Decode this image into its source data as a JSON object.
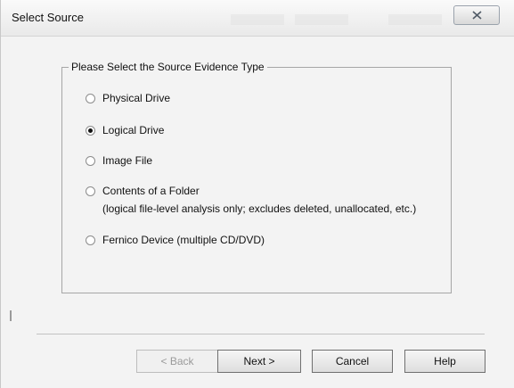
{
  "window": {
    "title": "Select Source",
    "close_icon": "close-icon"
  },
  "group": {
    "legend": "Please Select the Source Evidence Type",
    "options": [
      {
        "label": "Physical Drive",
        "checked": false
      },
      {
        "label": "Logical Drive",
        "checked": true
      },
      {
        "label": "Image File",
        "checked": false
      },
      {
        "label": "Contents of a Folder",
        "sublabel": "(logical file-level analysis only; excludes deleted, unallocated, etc.)",
        "checked": false
      },
      {
        "label": "Fernico Device (multiple CD/DVD)",
        "checked": false
      }
    ]
  },
  "buttons": {
    "back": "< Back",
    "next": "Next >",
    "cancel": "Cancel",
    "help": "Help"
  }
}
